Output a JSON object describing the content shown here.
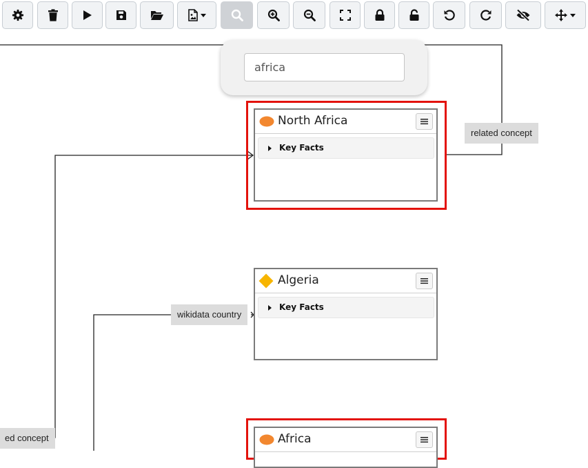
{
  "toolbar": {
    "buttons": [
      {
        "name": "settings-button",
        "icon": "gear-icon"
      },
      {
        "name": "delete-button",
        "icon": "trash-icon"
      },
      {
        "name": "run-button",
        "icon": "play-icon"
      },
      {
        "name": "save-button",
        "icon": "floppy-icon"
      },
      {
        "name": "open-button",
        "icon": "folder-open-icon"
      },
      {
        "name": "export-image-button",
        "icon": "file-image-icon",
        "dropdown": true
      },
      {
        "name": "search-button",
        "icon": "search-icon",
        "active": true
      },
      {
        "name": "zoom-in-button",
        "icon": "zoom-in-icon"
      },
      {
        "name": "zoom-out-button",
        "icon": "zoom-out-icon"
      },
      {
        "name": "fit-screen-button",
        "icon": "expand-icon"
      },
      {
        "name": "lock-button",
        "icon": "lock-icon"
      },
      {
        "name": "unlock-button",
        "icon": "unlock-icon"
      },
      {
        "name": "undo-button",
        "icon": "undo-icon"
      },
      {
        "name": "redo-button",
        "icon": "redo-icon"
      },
      {
        "name": "hide-button",
        "icon": "eye-slash-icon"
      },
      {
        "name": "move-button",
        "icon": "arrows-move-icon",
        "dropdown": true
      }
    ]
  },
  "search": {
    "value": "africa"
  },
  "nodes": [
    {
      "title": "North Africa",
      "shape": "ellipse",
      "color": "#f2872f",
      "facts_label": "Key Facts",
      "highlighted": true
    },
    {
      "title": "Algeria",
      "shape": "diamond",
      "color": "#f7b500",
      "facts_label": "Key Facts",
      "highlighted": false
    },
    {
      "title": "Africa",
      "shape": "ellipse",
      "color": "#f2872f",
      "highlighted": true
    }
  ],
  "edges": [
    {
      "label": "related concept"
    },
    {
      "label": "wikidata country"
    },
    {
      "label": "ed concept"
    }
  ]
}
